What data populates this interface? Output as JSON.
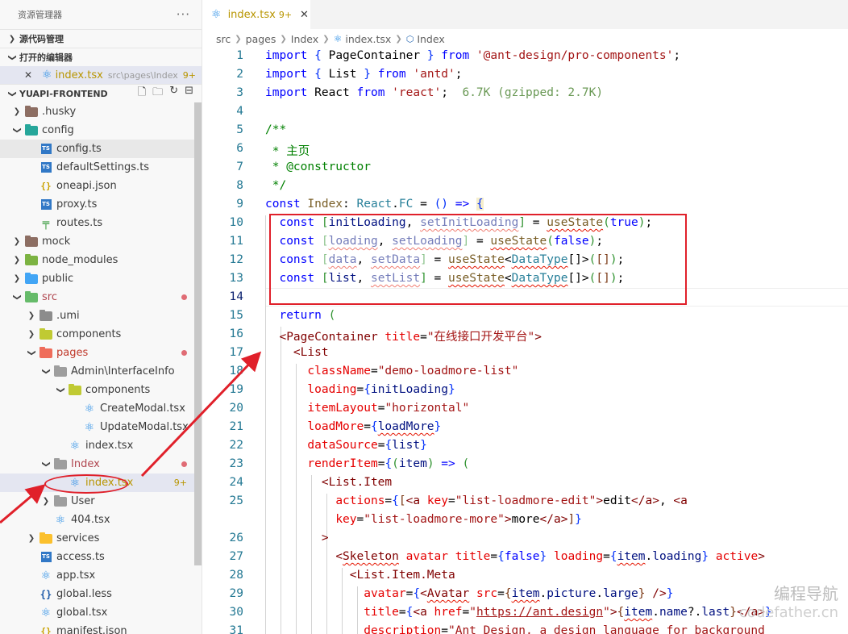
{
  "sidebar": {
    "title": "资源管理器",
    "more": "···",
    "scm_section": "源代码管理",
    "open_editors_section": "打开的编辑器",
    "open_editor": {
      "name": "index.tsx",
      "path": "src\\pages\\Index",
      "badge": "9+"
    },
    "project": "YUAPI-FRONTEND",
    "project_actions": [
      "new-file-icon",
      "new-folder-icon",
      "refresh-icon",
      "collapse-icon"
    ],
    "tree": [
      {
        "label": ".husky",
        "type": "folder",
        "color": "#8d6e63",
        "depth": 0,
        "expanded": false
      },
      {
        "label": "config",
        "type": "folder",
        "color": "#26a69a",
        "depth": 0,
        "expanded": true
      },
      {
        "label": "config.ts",
        "type": "ts",
        "depth": 1
      },
      {
        "label": "defaultSettings.ts",
        "type": "ts",
        "depth": 1
      },
      {
        "label": "oneapi.json",
        "type": "json",
        "depth": 1
      },
      {
        "label": "proxy.ts",
        "type": "ts",
        "depth": 1
      },
      {
        "label": "routes.ts",
        "type": "routes",
        "depth": 1
      },
      {
        "label": "mock",
        "type": "folder",
        "color": "#8d6e63",
        "depth": 0,
        "expanded": false
      },
      {
        "label": "node_modules",
        "type": "folder",
        "color": "#7cb342",
        "depth": 0,
        "expanded": false
      },
      {
        "label": "public",
        "type": "folder",
        "color": "#42a5f5",
        "depth": 0,
        "expanded": false
      },
      {
        "label": "src",
        "type": "folder",
        "color": "#66bb6a",
        "depth": 0,
        "expanded": true,
        "dot": true
      },
      {
        "label": ".umi",
        "type": "folder",
        "color": "#8c8c8c",
        "depth": 1,
        "expanded": false
      },
      {
        "label": "components",
        "type": "folder",
        "color": "#c0ca33",
        "depth": 1,
        "expanded": false
      },
      {
        "label": "pages",
        "type": "folder",
        "color": "#ef6c5a",
        "depth": 1,
        "expanded": true,
        "dot": true,
        "accent": true
      },
      {
        "label": "Admin\\InterfaceInfo",
        "type": "folder",
        "color": "#9e9e9e",
        "depth": 2,
        "expanded": true
      },
      {
        "label": "components",
        "type": "folder",
        "color": "#c0ca33",
        "depth": 3,
        "expanded": true
      },
      {
        "label": "CreateModal.tsx",
        "type": "react",
        "depth": 4
      },
      {
        "label": "UpdateModal.tsx",
        "type": "react",
        "depth": 4
      },
      {
        "label": "index.tsx",
        "type": "react",
        "depth": 3
      },
      {
        "label": "Index",
        "type": "folder",
        "color": "#9e9e9e",
        "depth": 2,
        "expanded": true,
        "dot": true
      },
      {
        "label": "index.tsx",
        "type": "react",
        "depth": 3,
        "selected": true,
        "err": "9+",
        "accent": true
      },
      {
        "label": "User",
        "type": "folder",
        "color": "#9e9e9e",
        "depth": 2,
        "expanded": false
      },
      {
        "label": "404.tsx",
        "type": "react",
        "depth": 2
      },
      {
        "label": "services",
        "type": "folder",
        "color": "#fbc02d",
        "depth": 1,
        "expanded": false
      },
      {
        "label": "access.ts",
        "type": "ts",
        "depth": 1
      },
      {
        "label": "app.tsx",
        "type": "react",
        "depth": 1
      },
      {
        "label": "global.less",
        "type": "less",
        "depth": 1
      },
      {
        "label": "global.tsx",
        "type": "react",
        "depth": 1
      },
      {
        "label": "manifest.json",
        "type": "json",
        "depth": 1
      }
    ]
  },
  "editor": {
    "tab": {
      "name": "index.tsx",
      "badge": "9+",
      "close": "✕"
    },
    "breadcrumb": [
      "src",
      "pages",
      "Index",
      "index.tsx",
      "Index"
    ],
    "line_numbers": [
      "1",
      "2",
      "3",
      "4",
      "5",
      "6",
      "7",
      "8",
      "9",
      "10",
      "11",
      "12",
      "13",
      "14",
      "15",
      "16",
      "17",
      "18",
      "19",
      "20",
      "21",
      "22",
      "23",
      "24",
      "25",
      "",
      "26",
      "27",
      "28",
      "29",
      "30",
      "31"
    ],
    "current_line": "14"
  },
  "watermark": {
    "line1": "编程导航",
    "line2": "codefather.cn"
  },
  "colors": {
    "annotation": "#e0202a",
    "warning": "#b89500",
    "keyword": "#0000ff",
    "string": "#a31515"
  }
}
